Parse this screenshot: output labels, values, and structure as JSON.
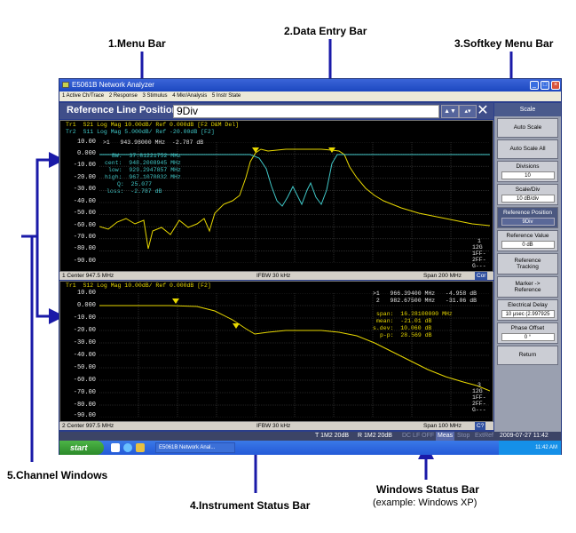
{
  "callouts": {
    "menu_bar": "1.Menu Bar",
    "data_entry_bar": "2.Data Entry Bar",
    "softkey_menu_bar": "3.Softkey Menu Bar",
    "instrument_status_bar": "4.Instrument Status Bar",
    "channel_windows": "5.Channel Windows",
    "windows_status_bar": "Windows Status Bar",
    "windows_status_bar_example": "(example: Windows XP)"
  },
  "window": {
    "title": "E5061B Network Analyzer"
  },
  "menu": {
    "items": [
      "1 Active Ch/Trace",
      "2 Response",
      "3 Stimulus",
      "4 Mkr/Analysis",
      "5 Instr State"
    ]
  },
  "data_entry": {
    "label": "Reference Line Position",
    "value": "9Div"
  },
  "channel1": {
    "trace1_header": "Tr1  S21 Log Mag 10.00dB/ Ref 0.000dB [F2 D&M Del]",
    "trace2_header": "Tr2  S11 Log Mag 5.000dB/ Ref -20.00dB [F2]",
    "marker_line": ">1   943.98000 MHz  -2.787 dB",
    "stats": [
      "BW:  37.81221752 MHz",
      "cent:  948.2008945 MHz",
      "low:  929.2947857 MHz",
      "high:  967.1070032 MHz",
      "Q:  25.077",
      "loss:  -2.787 dB"
    ],
    "y_ticks": [
      "10.00",
      "0.000",
      "-10.00",
      "-20.00",
      "-30.00",
      "-40.00",
      "-50.00",
      "-60.00",
      "-70.00",
      "-80.00",
      "-90.00"
    ],
    "right_labels": [
      "1",
      "12G",
      "1FF-",
      "2FF-",
      "G---"
    ],
    "status_left": "1  Center 947.5 MHz",
    "status_mid": "IFBW 30 kHz",
    "status_right": "Span 200 MHz",
    "status_badge": "Cor"
  },
  "channel2": {
    "trace1_header": "Tr1  S12 Log Mag 10.00dB/ Ref 0.000dB [F2]",
    "markers": [
      ">1   966.39400 MHz   -4.958 dB",
      " 2   982.67500 MHz   -31.06 dB"
    ],
    "stats": [
      "span:  16.28100000 MHz",
      "mean:  -21.01 dB",
      "s.dev:  10.060 dB",
      "p-p:  28.569 dB"
    ],
    "y_ticks": [
      "10.00",
      "0.000",
      "-10.00",
      "-20.00",
      "-30.00",
      "-40.00",
      "-50.00",
      "-60.00",
      "-70.00",
      "-80.00",
      "-90.00"
    ],
    "right_labels": [
      "3",
      "12G",
      "1FF-",
      "2FF-",
      "G---"
    ],
    "status_left": "2  Center 997.5 MHz",
    "status_mid": "IFBW 30 kHz",
    "status_right": "Span 100 MHz",
    "status_badge": "C?"
  },
  "softkeys": {
    "title": "Scale",
    "buttons": [
      {
        "label": "Auto Scale"
      },
      {
        "label": "Auto Scale All"
      },
      {
        "label": "Divisions",
        "value": "10"
      },
      {
        "label": "Scale/Div",
        "value": "10 dB/div"
      },
      {
        "label": "Reference Position",
        "value": "9Div"
      },
      {
        "label": "Reference Value",
        "value": "0 dB"
      },
      {
        "label": "Reference Tracking"
      },
      {
        "label": "Marker -> Reference"
      },
      {
        "label": "Electrical Delay",
        "value": "10 μsec (2.997925"
      },
      {
        "label": "Phase Offset",
        "value": "0 °"
      },
      {
        "label": "Return"
      }
    ]
  },
  "instrument_status": {
    "items": [
      "T 1M2 20dB",
      "R 1M2 20dB",
      "DC LF OFF",
      "Meas",
      "Stop",
      "ExtRef",
      "2009-07-27 11:42"
    ]
  },
  "taskbar": {
    "start": "start",
    "task": "E5061B Network Anal...",
    "clock": "11:42 AM"
  },
  "colors": {
    "trace_yellow": "#e8d800",
    "trace_cyan": "#40c8c8",
    "arrow_blue": "#1a1aa8"
  }
}
